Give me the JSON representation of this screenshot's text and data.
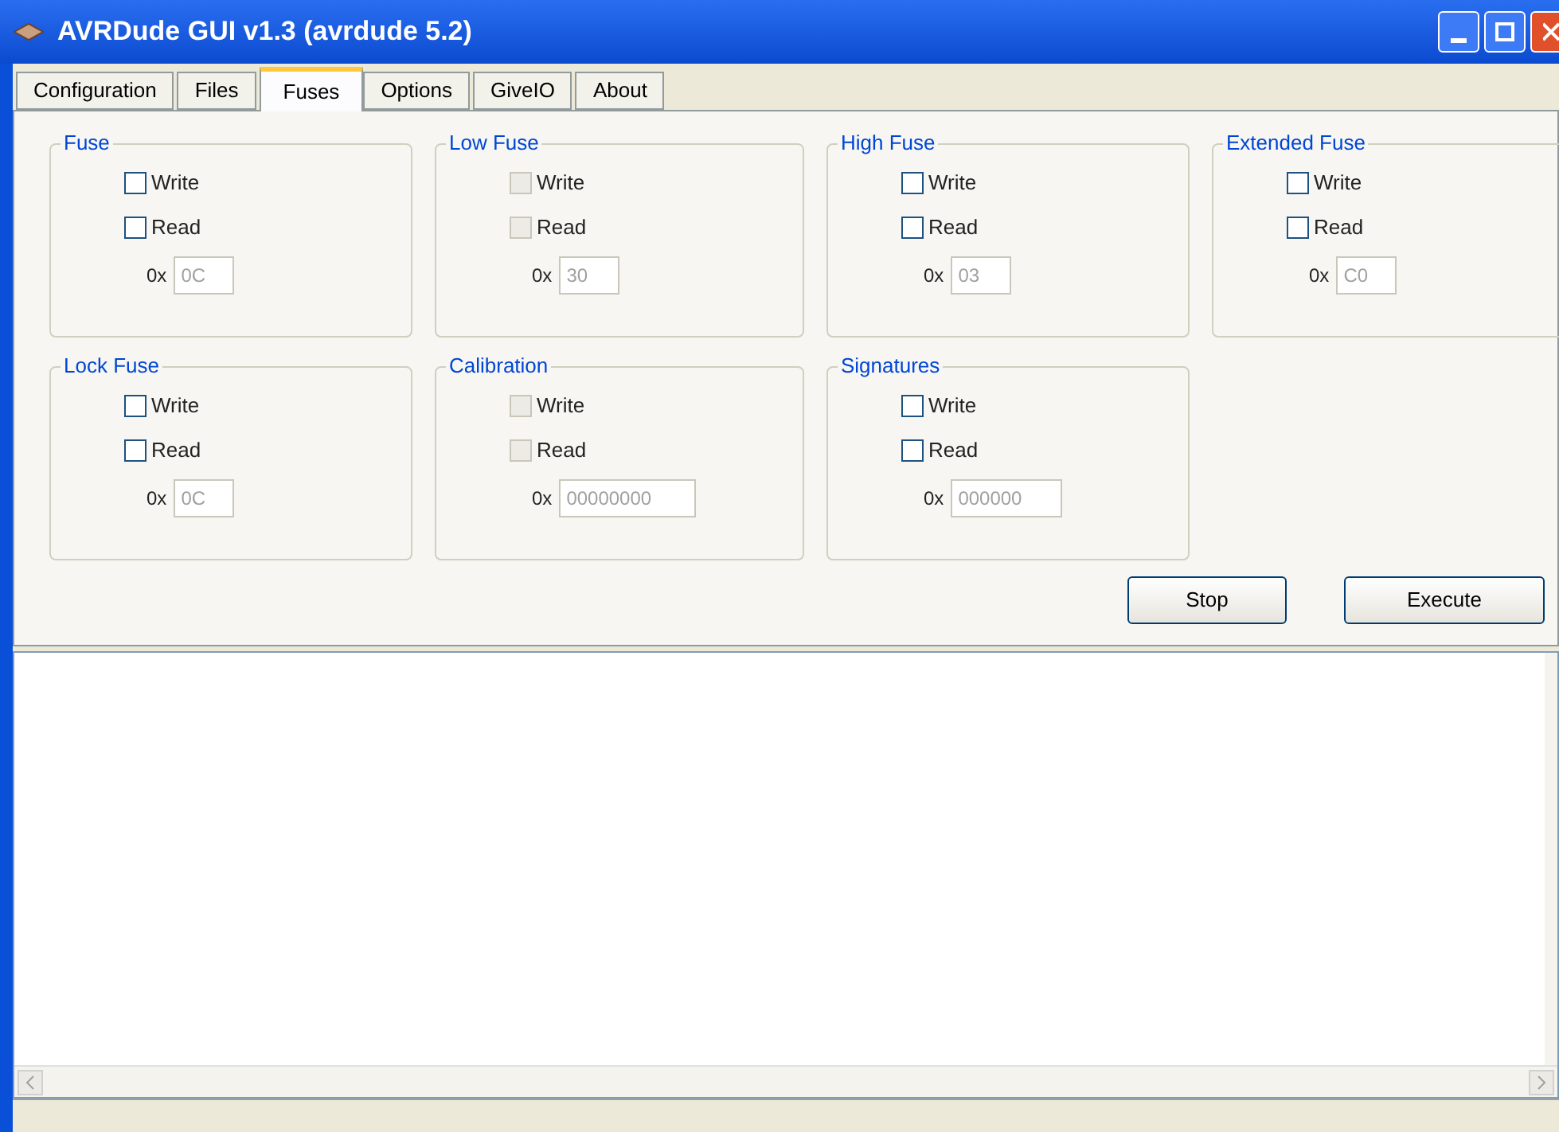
{
  "window": {
    "title": "AVRDude GUI v1.3 (avrdude 5.2)"
  },
  "tabs": [
    {
      "label": "Configuration",
      "selected": false
    },
    {
      "label": "Files",
      "selected": false
    },
    {
      "label": "Fuses",
      "selected": true
    },
    {
      "label": "Options",
      "selected": false
    },
    {
      "label": "GiveIO",
      "selected": false
    },
    {
      "label": "About",
      "selected": false
    }
  ],
  "groups": [
    {
      "title": "Fuse",
      "options": [
        {
          "label": "Write",
          "checked": false,
          "disabled": false
        },
        {
          "label": "Read",
          "checked": false,
          "disabled": false
        }
      ],
      "prefix": "0x",
      "value": "0C"
    },
    {
      "title": "Low Fuse",
      "options": [
        {
          "label": "Write",
          "checked": false,
          "disabled": true
        },
        {
          "label": "Read",
          "checked": false,
          "disabled": true
        }
      ],
      "prefix": "0x",
      "value": "30"
    },
    {
      "title": "High Fuse",
      "options": [
        {
          "label": "Write",
          "checked": false,
          "disabled": false
        },
        {
          "label": "Read",
          "checked": false,
          "disabled": false
        }
      ],
      "prefix": "0x",
      "value": "03"
    },
    {
      "title": "Extended Fuse",
      "options": [
        {
          "label": "Write",
          "checked": false,
          "disabled": false
        },
        {
          "label": "Read",
          "checked": false,
          "disabled": false
        }
      ],
      "prefix": "0x",
      "value": "C0"
    },
    {
      "title": "Lock Fuse",
      "options": [
        {
          "label": "Write",
          "checked": false,
          "disabled": false
        },
        {
          "label": "Read",
          "checked": false,
          "disabled": false
        }
      ],
      "prefix": "0x",
      "value": "0C"
    },
    {
      "title": "Calibration",
      "options": [
        {
          "label": "Write",
          "checked": false,
          "disabled": true
        },
        {
          "label": "Read",
          "checked": false,
          "disabled": true
        }
      ],
      "prefix": "0x",
      "value": "00000000"
    },
    {
      "title": "Signatures",
      "options": [
        {
          "label": "Write",
          "checked": false,
          "disabled": false
        },
        {
          "label": "Read",
          "checked": false,
          "disabled": false
        }
      ],
      "prefix": "0x",
      "value": "000000"
    }
  ],
  "buttons": [
    "Stop",
    "Execute"
  ]
}
